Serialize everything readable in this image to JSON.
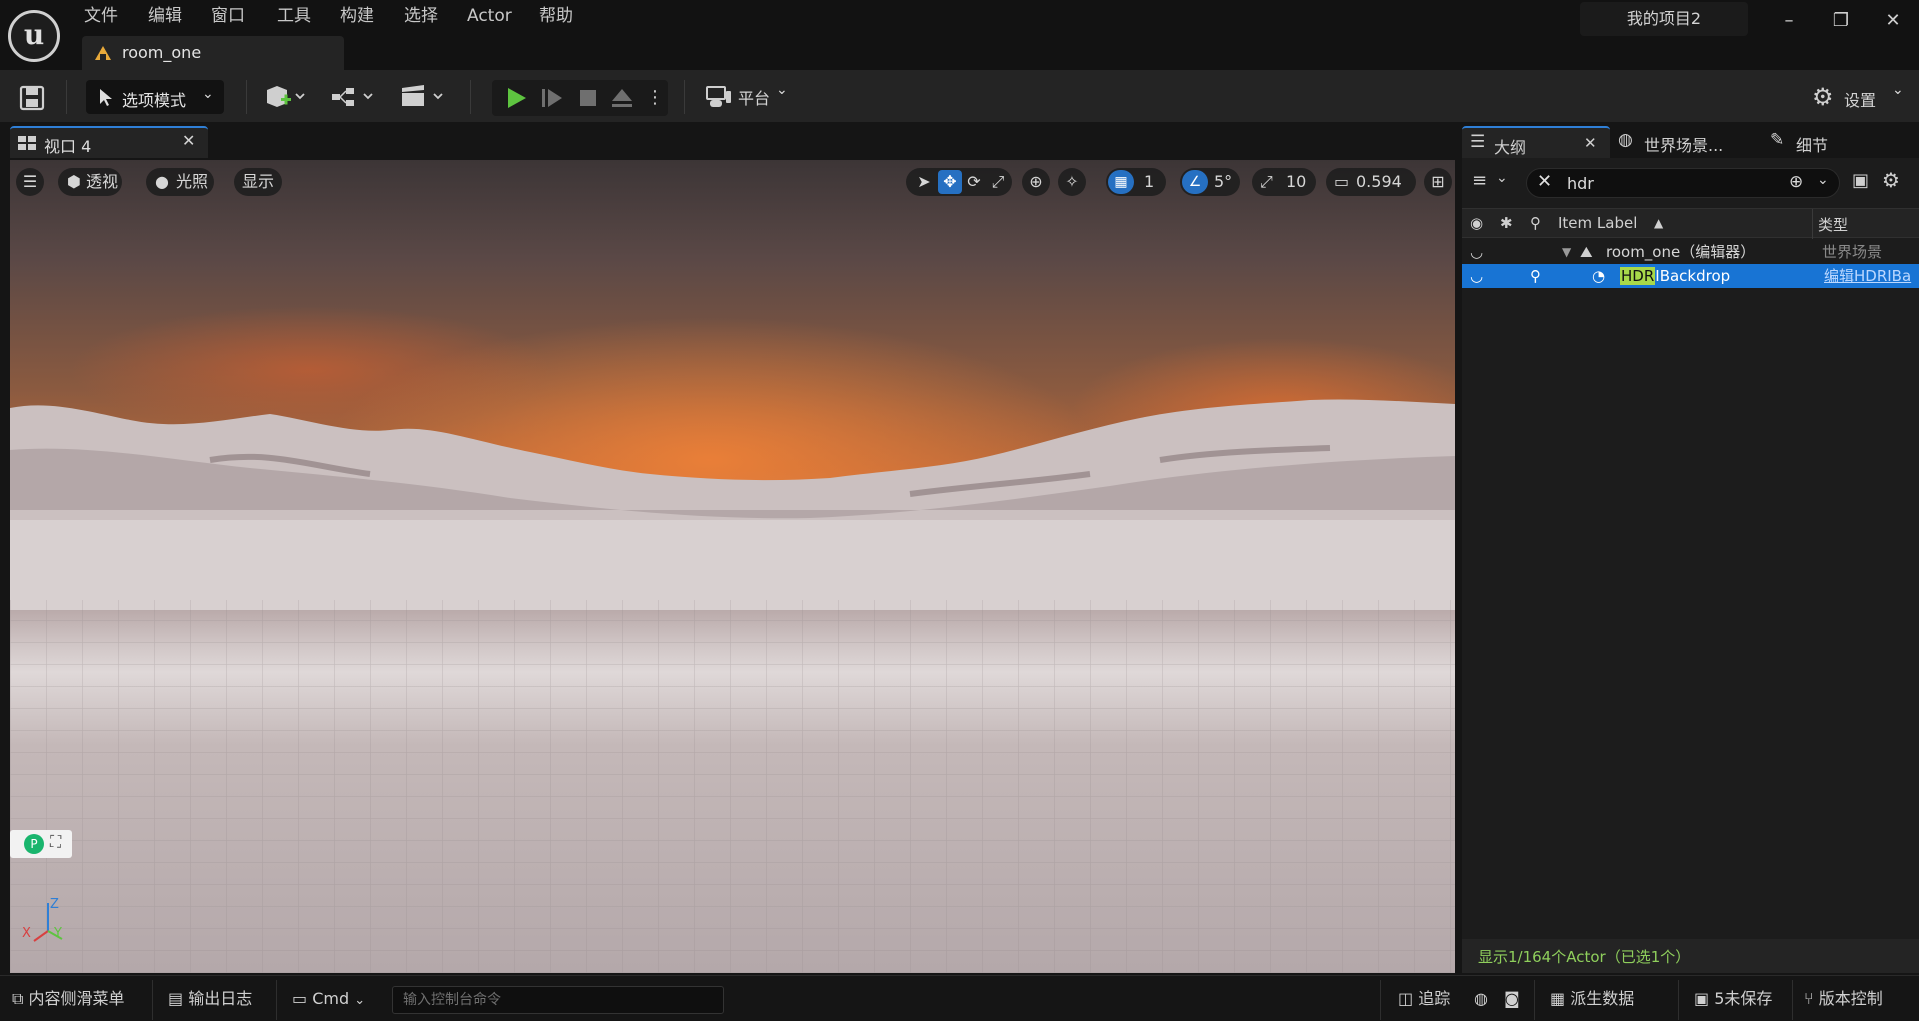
{
  "menu": [
    "文件",
    "编辑",
    "窗口",
    "工具",
    "构建",
    "选择",
    "Actor",
    "帮助"
  ],
  "document_tab": "room_one",
  "project_name": "我的项目2",
  "toolbar": {
    "mode_label": "选项模式",
    "platform_label": "平台",
    "settings_label": "设置"
  },
  "viewport": {
    "tab_label": "视口 4",
    "perspective_label": "透视",
    "lighting_label": "光照",
    "show_label": "显示",
    "grid_snap_value": "1",
    "rotation_snap_value": "5°",
    "scale_snap_value": "10",
    "camera_speed_value": "0.594",
    "gizmo_axes": {
      "x": "X",
      "y": "Y",
      "z": "Z"
    }
  },
  "outliner": {
    "tabs": [
      "大纲",
      "世界场景...",
      "细节"
    ],
    "search_value": "hdr",
    "columns": {
      "label": "Item Label",
      "type": "类型"
    },
    "rows": [
      {
        "label": "room_one（编辑器）",
        "type": "世界场景"
      },
      {
        "label_highlight": "HDR",
        "label_rest": "IBackdrop",
        "type": "编辑HDRIBa"
      }
    ],
    "status": "显示1/164个Actor（已选1个）"
  },
  "bottom_bar": {
    "content_drawer": "内容侧滑菜单",
    "output_log": "输出日志",
    "cmd": "Cmd",
    "console_placeholder": "输入控制台命令",
    "trace": "追踪",
    "derived_data": "派生数据",
    "unsaved": "5未保存",
    "source_control": "版本控制"
  },
  "colors": {
    "accent_blue": "#2670c2",
    "selection_blue": "#1874d4",
    "play_green": "#5ec440",
    "status_green": "#8fcf5c"
  }
}
